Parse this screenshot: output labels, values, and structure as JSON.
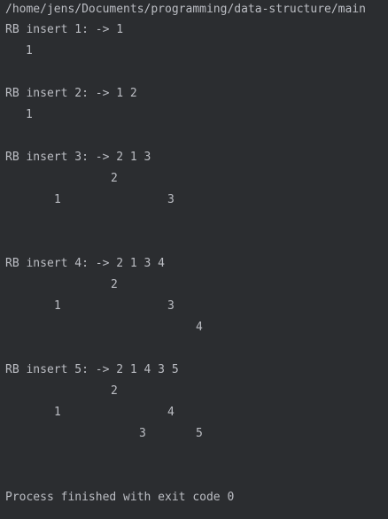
{
  "console": {
    "path": "/home/jens/Documents/programming/data-structure/main",
    "blocks": [
      {
        "title": "RB insert 1: -> 1",
        "nodes": [
          "1"
        ]
      },
      {
        "title": "RB insert 2: -> 1 2",
        "nodes": [
          "1"
        ]
      },
      {
        "title": "RB insert 3: -> 2 1 3",
        "nodes": [
          "2",
          "1",
          "3"
        ]
      },
      {
        "title": "RB insert 4: -> 2 1 3 4",
        "nodes": [
          "2",
          "1",
          "3",
          "4"
        ]
      },
      {
        "title": "RB insert 5: -> 2 1 4 3 5",
        "nodes": [
          "2",
          "1",
          "4",
          "3",
          "5"
        ]
      }
    ],
    "exit_message": "Process finished with exit code 0"
  }
}
